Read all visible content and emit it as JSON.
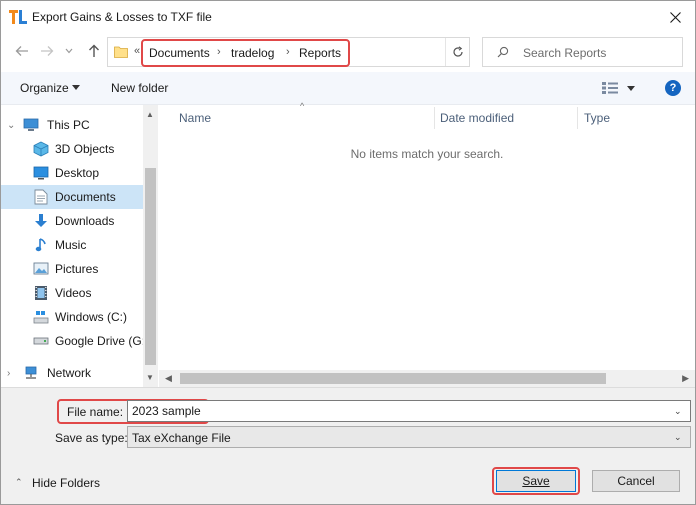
{
  "window": {
    "title": "Export Gains & Losses to TXF file",
    "app_icon": "tradelog-icon"
  },
  "navigation": {
    "overflow": "«",
    "breadcrumbs": [
      "Documents",
      "tradelog",
      "Reports"
    ],
    "search_placeholder": "Search Reports"
  },
  "toolbar": {
    "organize_label": "Organize",
    "new_folder_label": "New folder",
    "help_label": "?"
  },
  "sidebar": {
    "items": [
      {
        "label": "This PC",
        "icon": "computer-icon"
      },
      {
        "label": "3D Objects",
        "icon": "cube-icon"
      },
      {
        "label": "Desktop",
        "icon": "desktop-icon"
      },
      {
        "label": "Documents",
        "icon": "document-icon",
        "selected": true
      },
      {
        "label": "Downloads",
        "icon": "download-icon"
      },
      {
        "label": "Music",
        "icon": "music-icon"
      },
      {
        "label": "Pictures",
        "icon": "picture-icon"
      },
      {
        "label": "Videos",
        "icon": "video-icon"
      },
      {
        "label": "Windows (C:)",
        "icon": "drive-icon"
      },
      {
        "label": "Google Drive (G:",
        "icon": "drive-icon"
      },
      {
        "label": "Network",
        "icon": "network-icon"
      }
    ]
  },
  "filelist": {
    "columns": [
      "Name",
      "Date modified",
      "Type"
    ],
    "empty_message": "No items match your search."
  },
  "form": {
    "file_name_label": "File name:",
    "file_name_value": "2023 sample",
    "save_as_type_label": "Save as type:",
    "save_as_type_value": "Tax eXchange File"
  },
  "footer": {
    "hide_folders_label": "Hide Folders",
    "save_label": "Save",
    "cancel_label": "Cancel"
  },
  "colors": {
    "highlight": "#e04848",
    "accent": "#0078d7",
    "selected_bg": "#cce4f7"
  }
}
